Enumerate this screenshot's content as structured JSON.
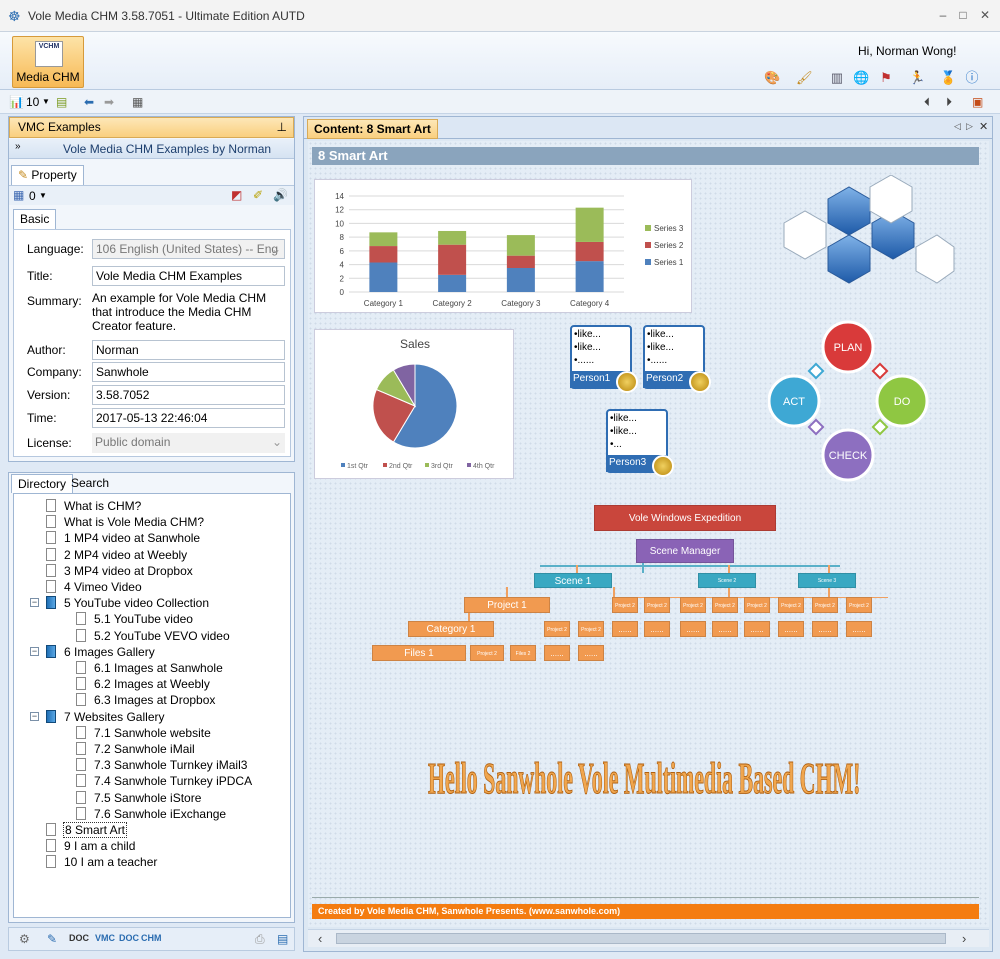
{
  "window": {
    "title": "Vole Media CHM  3.58.7051 - Ultimate Edition AUTD",
    "controls": [
      "–",
      "□",
      "✕"
    ]
  },
  "ribbon": {
    "app_button": "Media CHM",
    "app_icon_text": "VCHM",
    "greeting": "Hi, Norman Wong!"
  },
  "toolbar": {
    "count": "10"
  },
  "left_top": {
    "title": "VMC Examples",
    "pin": "ᵖ",
    "examples_label": "Vole Media CHM Examples by Norman",
    "property_tab": "Property",
    "count": "0",
    "basic_tab": "Basic"
  },
  "props": {
    "language_label": "Language:",
    "language": "106 English (United States) -- Eng",
    "title_label": "Title:",
    "title": "Vole Media CHM Examples",
    "summary_label": "Summary:",
    "summary": "An example for Vole Media CHM that introduce the Media CHM Creator feature.",
    "author_label": "Author:",
    "author": "Norman",
    "company_label": "Company:",
    "company": "Sanwhole",
    "version_label": "Version:",
    "version": "3.58.7052",
    "time_label": "Time:",
    "time": "2017-05-13 22:46:04",
    "license_label": "License:",
    "license": "Public domain"
  },
  "left_bottom": {
    "tab_directory": "Directory",
    "tab_search": "Search"
  },
  "tree": [
    "What is CHM?",
    "What is Vole Media CHM?",
    "1 MP4 video at Sanwhole",
    "2 MP4 video at Weebly",
    "3 MP4 video at Dropbox",
    "4 Vimeo Video",
    "5 YouTube video Collection",
    "5.1 YouTube video",
    "5.2 YouTube VEVO video",
    "6 Images Gallery",
    "6.1 Images at Sanwhole",
    "6.2 Images at Weebly",
    "6.3 Images at Dropbox",
    "7 Websites Gallery",
    "7.1 Sanwhole website",
    "7.2 Sanwhole iMail",
    "7.3 Sanwhole Turnkey iMail3",
    "7.4 Sanwhole Turnkey iPDCA",
    "7.5 Sanwhole iStore",
    "7.6 Sanwhole iExchange",
    "8 Smart Art",
    "9 I am a child",
    "10 I am a teacher"
  ],
  "status_left": {
    "vmc": "VMC",
    "doc": "DOC",
    "chm": "CHM"
  },
  "content": {
    "tab": "Content: 8 Smart Art",
    "heading": "8 Smart Art",
    "footer": "Created by Vole Media CHM, Sanwhole Presents. (www.sanwhole.com)",
    "wordart": "Hello Sanwhole Vole Multimedia Based CHM!",
    "cycle": [
      "PLAN",
      "DO",
      "CHECK",
      "ACT"
    ],
    "persons": [
      {
        "name": "Person1",
        "lines": [
          "•like...",
          "•like...",
          "•......"
        ]
      },
      {
        "name": "Person2",
        "lines": [
          "•like...",
          "•like...",
          "•......"
        ]
      },
      {
        "name": "Person3",
        "lines": [
          "•like...",
          "•like...",
          "•..."
        ]
      }
    ],
    "org": {
      "top": "Vole Windows Expedition",
      "manager": "Scene Manager",
      "scene1": "Scene 1",
      "scene2": "Scene 2",
      "scene3": "Scene 3",
      "project": "Project 1",
      "category": "Category 1",
      "files": "Files 1",
      "small_project": "Project 2",
      "small": "Project 2",
      "small_file": "Files 2",
      "dots": "......"
    }
  },
  "chart_data": [
    {
      "type": "bar",
      "stacked": true,
      "categories": [
        "Category 1",
        "Category 2",
        "Category 3",
        "Category 4"
      ],
      "series": [
        {
          "name": "Series 1",
          "values": [
            4.3,
            2.5,
            3.5,
            4.5
          ],
          "color": "#4f81bd"
        },
        {
          "name": "Series 2",
          "values": [
            2.4,
            4.4,
            1.8,
            2.8
          ],
          "color": "#c0504d"
        },
        {
          "name": "Series 3",
          "values": [
            2,
            2,
            3,
            5
          ],
          "color": "#9bbb59"
        }
      ],
      "ylim": [
        0,
        14
      ],
      "yticks": [
        "0",
        "2",
        "4",
        "6",
        "8",
        "10",
        "12",
        "14"
      ],
      "legend": "right",
      "grid": true
    },
    {
      "type": "pie",
      "title": "Sales",
      "categories": [
        "1st Qtr",
        "2nd Qtr",
        "3rd Qtr",
        "4th Qtr"
      ],
      "values": [
        8.2,
        3.2,
        1.4,
        1.2
      ],
      "colors": [
        "#4f81bd",
        "#c0504d",
        "#9bbb59",
        "#8064a2"
      ],
      "legend": "bottom"
    }
  ]
}
